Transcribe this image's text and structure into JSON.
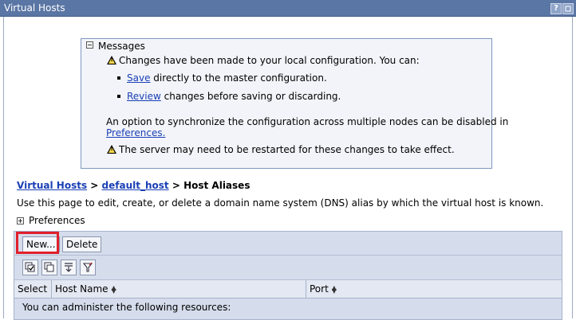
{
  "window": {
    "title": "Virtual Hosts",
    "help_label": "?"
  },
  "messages": {
    "header": "Messages",
    "changes_notice": "Changes have been made to your local configuration. You can:",
    "save_link": "Save",
    "save_text": "directly to the master configuration.",
    "review_link": "Review",
    "review_text": "changes before saving or discarding.",
    "sync_text": "An option to synchronize the configuration across multiple nodes can be disabled in",
    "preferences_link": "Preferences.",
    "restart_text": "The server may need to be restarted for these changes to take effect."
  },
  "breadcrumb": {
    "item1": "Virtual Hosts",
    "sep": ">",
    "item2": "default_host",
    "current": "Host Aliases"
  },
  "description": "Use this page to edit, create, or delete a domain name system (DNS) alias by which the virtual host is known.",
  "preferences_label": "Preferences",
  "toolbar": {
    "new_label": "New...",
    "delete_label": "Delete"
  },
  "icon_toolbar": [
    "select-all-icon",
    "deselect-all-icon",
    "show-filter-icon",
    "clear-filter-icon"
  ],
  "table": {
    "headers": {
      "select": "Select",
      "host_name": "Host Name",
      "port": "Port"
    },
    "info_row": "You can administer the following resources:"
  },
  "colors": {
    "titlebar": "#5a76a4",
    "highlight": "#e0202b",
    "link": "#1a3fb5",
    "panel": "#d5dceb"
  }
}
